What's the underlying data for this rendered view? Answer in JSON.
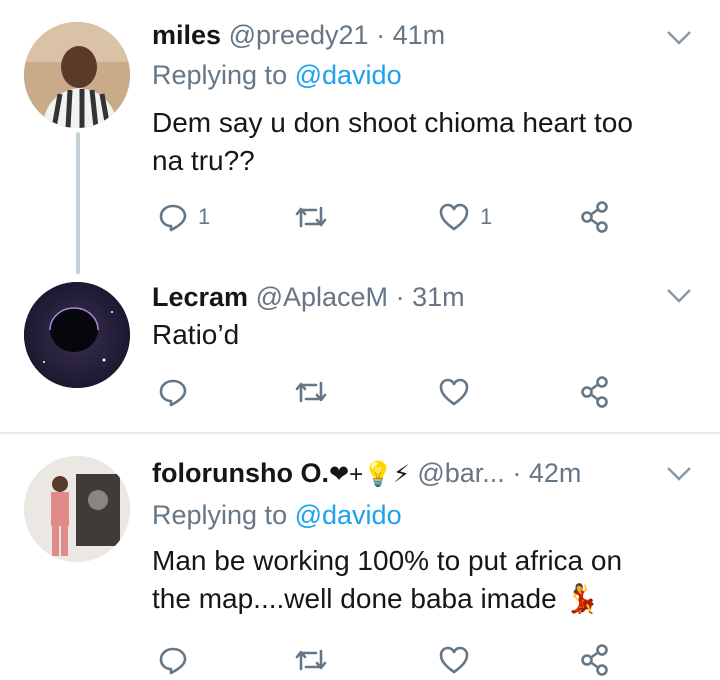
{
  "colors": {
    "link": "#1da1f2",
    "muted": "#657786",
    "text": "#14171a",
    "thread": "#c4cfd6",
    "divider": "#e6ecf0"
  },
  "tweets": [
    {
      "name": "miles",
      "handle": "@preedy21",
      "separator": "·",
      "time": "41m",
      "replying_prefix": "Replying to",
      "replying_to": "@davido",
      "text_line1": "Dem say u don shoot chioma heart too",
      "text_line2": "na tru??",
      "reply_count": "1",
      "like_count": "1",
      "avatar_icon": "person-avatar",
      "menu_icon": "chevron-down-icon"
    },
    {
      "name": "Lecram",
      "handle": "@AplaceM",
      "separator": "·",
      "time": "31m",
      "text_line1": "Ratio’d",
      "reply_count": "",
      "like_count": "",
      "avatar_icon": "space-planet-avatar",
      "menu_icon": "chevron-down-icon"
    },
    {
      "name": "folorunsho O.",
      "name_emoji": "❤+💡⚡",
      "handle": "@bar...",
      "separator": "·",
      "time": "42m",
      "replying_prefix": "Replying to",
      "replying_to": "@davido",
      "text_line1": "Man be working 100% to put africa on",
      "text_line2": "the map....well done baba imade",
      "text_emoji": "💃",
      "avatar_icon": "person-avatar",
      "menu_icon": "chevron-down-icon"
    }
  ]
}
